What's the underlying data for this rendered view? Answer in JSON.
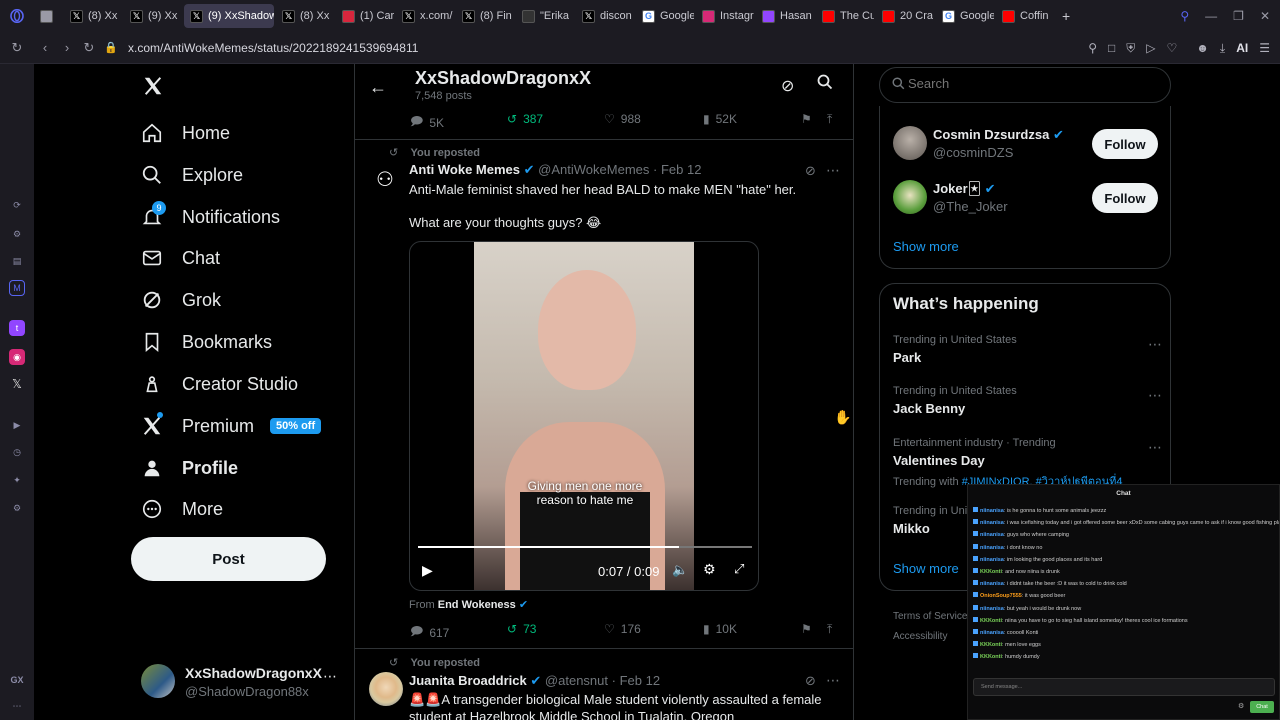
{
  "browser": {
    "tabs": [
      {
        "label": "",
        "icon": "window-icon",
        "color": "#9a9aa6"
      },
      {
        "label": "(8) Xx",
        "icon": "x-logo",
        "color": "#000000"
      },
      {
        "label": "(9) Xx",
        "icon": "x-logo",
        "color": "#000000"
      },
      {
        "label": "(9) XxShadow",
        "icon": "x-logo",
        "color": "#000000",
        "active": true
      },
      {
        "label": "(8) Xx",
        "icon": "x-logo",
        "color": "#000000"
      },
      {
        "label": "(1) Car",
        "icon": "play-icon",
        "color": "#d7263d"
      },
      {
        "label": "x.com/",
        "icon": "x-logo",
        "color": "#000000"
      },
      {
        "label": "(8) Fin",
        "icon": "x-logo",
        "color": "#000000"
      },
      {
        "label": "\"Erika",
        "icon": "quote-icon",
        "color": "#333333"
      },
      {
        "label": "discon",
        "icon": "x-logo",
        "color": "#000000"
      },
      {
        "label": "Google",
        "icon": "google-icon",
        "color": "#ffffff"
      },
      {
        "label": "Instagr",
        "icon": "instagram-icon",
        "color": "#d62976"
      },
      {
        "label": "Hasan",
        "icon": "twitch-icon",
        "color": "#9146ff"
      },
      {
        "label": "The Cu",
        "icon": "youtube-icon",
        "color": "#ff0000"
      },
      {
        "label": "20 Cra",
        "icon": "youtube-icon",
        "color": "#ff0000"
      },
      {
        "label": "Google",
        "icon": "google-icon",
        "color": "#ffffff"
      },
      {
        "label": "Coffin",
        "icon": "youtube-icon",
        "color": "#ff0000"
      }
    ],
    "new_tab": "+",
    "url": "x.com/AntiWokeMemes/status/2022189241539694811",
    "ai_label": "AI",
    "gx_label": "GX"
  },
  "nav": {
    "items": [
      {
        "label": "Home",
        "icon": "home-icon"
      },
      {
        "label": "Explore",
        "icon": "search-icon"
      },
      {
        "label": "Notifications",
        "icon": "bell-icon",
        "badge": "9"
      },
      {
        "label": "Chat",
        "icon": "mail-icon"
      },
      {
        "label": "Grok",
        "icon": "grok-icon"
      },
      {
        "label": "Bookmarks",
        "icon": "bookmark-icon"
      },
      {
        "label": "Creator Studio",
        "icon": "creator-icon"
      },
      {
        "label": "Premium",
        "icon": "x-logo-icon",
        "badge": "50% off"
      },
      {
        "label": "Profile",
        "icon": "person-icon"
      },
      {
        "label": "More",
        "icon": "more-circle-icon"
      }
    ],
    "post_button": "Post",
    "account_name": "XxShadowDragonxX",
    "account_handle": "@ShadowDragon88x"
  },
  "header": {
    "title": "XxShadowDragonxX",
    "subtitle": "7,548 posts"
  },
  "prev_stats": {
    "replies": "5K",
    "reposts": "387",
    "likes": "988",
    "views": "52K"
  },
  "post1": {
    "repost_label": "You reposted",
    "author": "Anti Woke Memes",
    "handle": "@AntiWokeMemes",
    "date": "Feb 12",
    "text1": "Anti-Male feminist shaved her head BALD to make MEN \"hate\" her.",
    "text2": "What are your thoughts guys? 😂",
    "video_caption_1": "Giving men one more",
    "video_caption_2": "reason to hate me",
    "video_time": "0:07 / 0:09",
    "video_progress": 0.78,
    "from_label": "From",
    "from_source": "End Wokeness",
    "stats": {
      "replies": "617",
      "reposts": "73",
      "likes": "176",
      "views": "10K"
    }
  },
  "post2": {
    "repost_label": "You reposted",
    "author": "Juanita Broaddrick",
    "handle": "@atensnut",
    "date": "Feb 12",
    "text": "🚨🚨A transgender biological Male student violently assaulted a female student at Hazelbrook Middle School in Tualatin, Oregon"
  },
  "search": {
    "placeholder": "Search"
  },
  "who_to_follow": {
    "accounts": [
      {
        "name": "Cosmin Dzsurdzsa",
        "handle": "@cosminDZS",
        "button": "Follow"
      },
      {
        "name": "Joker🃏",
        "handle": "@The_Joker",
        "button": "Follow"
      }
    ],
    "show_more": "Show more"
  },
  "happening": {
    "title": "What’s happening",
    "trends": [
      {
        "category": "Trending in United States",
        "name": "Park"
      },
      {
        "category": "Trending in United States",
        "name": "Jack Benny"
      },
      {
        "category": "Entertainment industry · Trending",
        "name": "Valentines Day",
        "extra_prefix": "Trending with",
        "extra": "#JIMINxDIOR, #วิวาห์ปฐพีตอนที่4"
      },
      {
        "category": "Trending in Uni",
        "name": "Mikko"
      }
    ],
    "show_more": "Show more"
  },
  "footer": {
    "terms": "Terms of Service",
    "accessibility": "Accessibility"
  },
  "chat": {
    "title": "Chat",
    "messages": [
      {
        "user": "niinanisa",
        "text": "is he gonna to hunt some animals jeezzz",
        "color": "#4aa3ff"
      },
      {
        "user": "niinanisa",
        "text": "i was icefishing today and i got offered some beer xDxD some cabing guys came to ask if i know good fishing places",
        "color": "#4aa3ff"
      },
      {
        "user": "niinanisa",
        "text": "guys who where camping",
        "color": "#4aa3ff"
      },
      {
        "user": "niinanisa",
        "text": "i dont know no",
        "color": "#4aa3ff"
      },
      {
        "user": "niinanisa",
        "text": "im looking the good places and its hard",
        "color": "#4aa3ff"
      },
      {
        "user": "KKKonti",
        "text": "and now niina is drunk",
        "color": "#7cd65a"
      },
      {
        "user": "niinanisa",
        "text": "i didnt take the beer :D it was to cold to drink cold",
        "color": "#4aa3ff"
      },
      {
        "user": "OnionSoup7555",
        "text": "it was good beer",
        "color": "#ff9f1a"
      },
      {
        "user": "niinanisa",
        "text": "but yeah i would be drunk now",
        "color": "#4aa3ff"
      },
      {
        "user": "KKKonti",
        "text": "niina you have to go to sieg hall island someday! theres cool ice formations",
        "color": "#7cd65a"
      },
      {
        "user": "niinanisa",
        "text": "cooooll Konti",
        "color": "#4aa3ff"
      },
      {
        "user": "KKKonti",
        "text": "men love eggs",
        "color": "#7cd65a"
      },
      {
        "user": "KKKonti",
        "text": "humdy dumdy",
        "color": "#7cd65a"
      }
    ],
    "input_placeholder": "Send message...",
    "send_label": "Chat"
  }
}
